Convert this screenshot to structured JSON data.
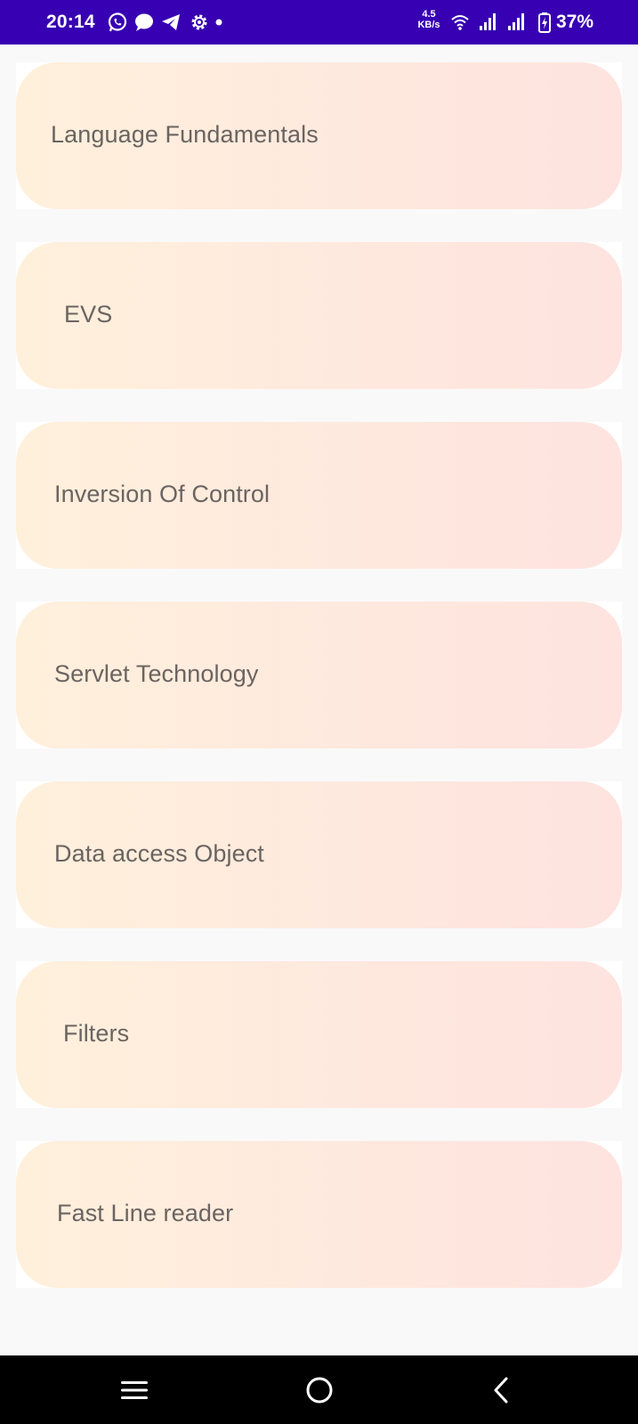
{
  "status_bar": {
    "time": "20:14",
    "left_icons": [
      "whatsapp-icon",
      "chat-bubble-icon",
      "telegram-icon",
      "settings-gear-icon",
      "notification-dot-icon"
    ],
    "network_speed_value": "4.5",
    "network_speed_unit": "KB/s",
    "right_icons": [
      "wifi-icon",
      "signal-icon",
      "signal-icon",
      "battery-charging-icon"
    ],
    "battery_percent": "37%"
  },
  "topics": [
    {
      "label": "Language Fundamentals"
    },
    {
      "label": "EVS"
    },
    {
      "label": "Inversion Of Control"
    },
    {
      "label": "Servlet Technology"
    },
    {
      "label": "Data access Object"
    },
    {
      "label": "Filters"
    },
    {
      "label": "Fast Line reader"
    }
  ],
  "nav_bar": {
    "buttons": [
      "recent-apps-icon",
      "home-icon",
      "back-icon"
    ]
  },
  "colors": {
    "status_bar": "#3700b3",
    "background": "#f9f9f9",
    "card_gradient_start": "#fff0dc",
    "card_gradient_end": "#fee3df",
    "card_text": "#6b6461",
    "nav_bar": "#000000"
  }
}
